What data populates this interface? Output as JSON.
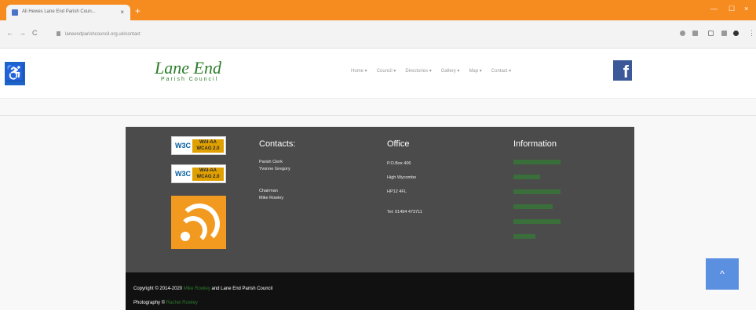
{
  "browser": {
    "tab_title": "Ali Hewes Lane End Parish Coun...",
    "tab_close": "×",
    "new_tab": "+",
    "url": "laneendparishcouncil.org.uk/contact",
    "back": "←",
    "forward": "→",
    "reload": "C",
    "minimize": "—",
    "maximize": "☐",
    "close": "×",
    "menu": "⋮"
  },
  "site": {
    "logo_title": "Lane End",
    "logo_sub": "Parish Council",
    "nav": [
      "Home ▾",
      "Council ▾",
      "Directories ▾",
      "Gallery ▾",
      "Map ▾",
      "Contact ▾"
    ],
    "accessibility_glyph": "♿",
    "facebook_glyph": "f"
  },
  "footer": {
    "wcag_badge_1": {
      "w3c": "W3C",
      "line1": "WAI-AA",
      "line2": "WCAG 2.0"
    },
    "wcag_badge_2": {
      "w3c": "W3C",
      "line1": "WAI-AA",
      "line2": "WCAG 2.0"
    },
    "contacts": {
      "heading": "Contacts:",
      "role1": "Parish Clerk",
      "name1": "Yvonne Gregory",
      "role2": "Chairman",
      "name2": "Mike Rowley"
    },
    "office": {
      "heading": "Office",
      "line1": "P.O.Box 406",
      "line2": "High Wycombe",
      "line3": "HP12 4FL",
      "tel": "Tel: 01494 473711"
    },
    "information": {
      "heading": "Information"
    }
  },
  "copyright": {
    "line1_pre": "Copyright © 2014-2020",
    "line1_link": "Mike Rowley",
    "line1_post": "and Lane End Parish Council",
    "line2_pre": "Photography ©",
    "line2_link": "Rachel Rowley"
  },
  "back_to_top_glyph": "^",
  "colors": {
    "titlebar": "#f68b1f",
    "brand_green": "#2b7d2b",
    "footer_bg": "#4b4b4b",
    "rss": "#f29a1f",
    "facebook": "#3b5998",
    "access_blue": "#1c64c9",
    "back_to_top": "#5b8fe0"
  }
}
